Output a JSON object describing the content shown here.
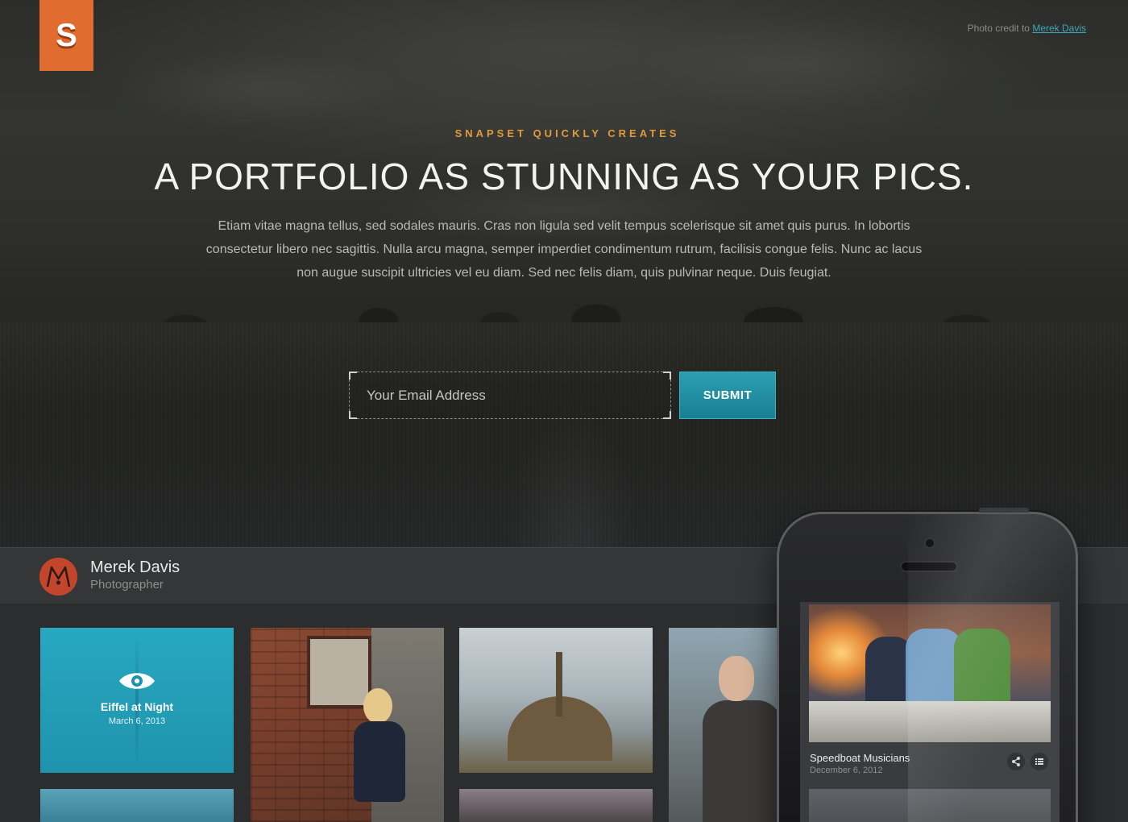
{
  "logo": {
    "letter": "S",
    "color": "#e06d2f"
  },
  "credit": {
    "prefix": "Photo credit to",
    "link": "Merek Davis"
  },
  "hero": {
    "eyebrow": "SNAPSET QUICKLY CREATES",
    "headline": "A PORTFOLIO AS STUNNING AS YOUR PICS.",
    "lede": "Etiam vitae magna tellus, sed sodales mauris. Cras non ligula sed velit tempus scelerisque sit amet quis purus. In lobortis consectetur libero nec sagittis. Nulla arcu magna, semper imperdiet condimentum rutrum, facilisis congue felis. Nunc ac lacus non augue suscipit ultricies vel eu diam. Sed nec felis diam, quis pulvinar neque. Duis feugiat."
  },
  "signup": {
    "email_placeholder": "Your Email Address",
    "email_value": "",
    "submit_label": "SUBMIT",
    "accent": "#1f8fa3"
  },
  "profile": {
    "name": "Merek Davis",
    "title": "Photographer"
  },
  "gallery": {
    "featured": {
      "title": "Eiffel at Night",
      "date": "March 6, 2013",
      "icon": "eye-icon"
    }
  },
  "phone": {
    "post": {
      "title": "Speedboat Musicians",
      "date": "December 6, 2012"
    },
    "icons": [
      "share-icon",
      "list-icon"
    ]
  }
}
